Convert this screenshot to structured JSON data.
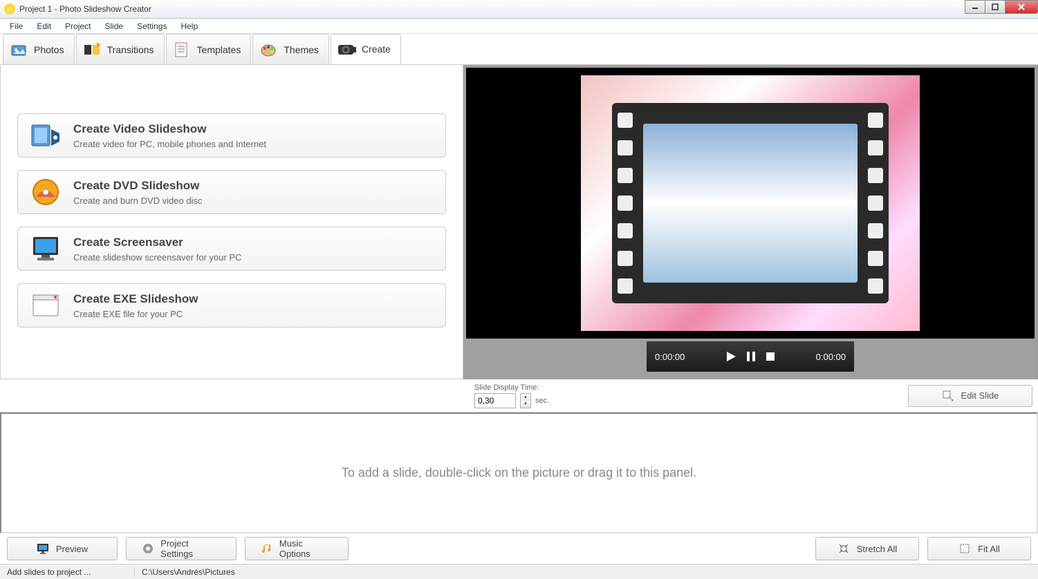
{
  "window": {
    "title": "Project 1 - Photo Slideshow Creator"
  },
  "menu": {
    "items": [
      "File",
      "Edit",
      "Project",
      "Slide",
      "Settings",
      "Help"
    ]
  },
  "tabs": {
    "photos": "Photos",
    "transitions": "Transitions",
    "templates": "Templates",
    "themes": "Themes",
    "create": "Create",
    "active": "create"
  },
  "create_options": {
    "video": {
      "title": "Create Video Slideshow",
      "desc": "Create video for PC, mobile phones and Internet"
    },
    "dvd": {
      "title": "Create DVD Slideshow",
      "desc": "Create and burn DVD video disc"
    },
    "screensaver": {
      "title": "Create Screensaver",
      "desc": "Create slideshow screensaver for your PC"
    },
    "exe": {
      "title": "Create EXE Slideshow",
      "desc": "Create EXE file for your PC"
    }
  },
  "player": {
    "time_left": "0:00:00",
    "time_right": "0:00:00"
  },
  "slide_time": {
    "label": "Slide Display Time:",
    "value": "0,30",
    "unit": "sec."
  },
  "edit_slide_label": "Edit Slide",
  "timeline_hint": "To add a slide, double-click on the picture or drag it to this panel.",
  "bottom": {
    "preview": "Preview",
    "project_settings": "Project Settings",
    "music_options": "Music Options",
    "stretch_all": "Stretch All",
    "fit_all": "Fit All"
  },
  "status": {
    "left": "Add slides to project ...",
    "path": "C:\\Users\\Andrés\\Pictures"
  }
}
